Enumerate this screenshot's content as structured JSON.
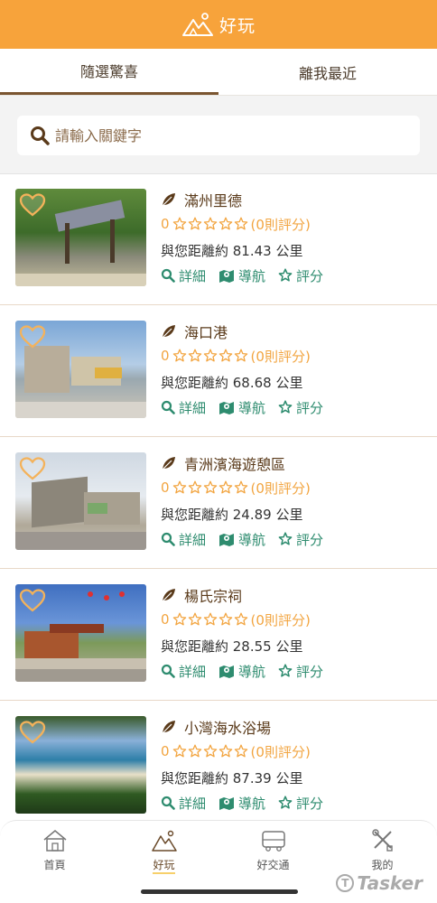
{
  "header": {
    "title": "好玩",
    "icon": "mountain-icon"
  },
  "tabs": [
    {
      "label": "隨選驚喜",
      "active": true
    },
    {
      "label": "離我最近",
      "active": false
    }
  ],
  "search": {
    "placeholder": "請輸入關鍵字",
    "value": ""
  },
  "items": [
    {
      "name": "滿州里德",
      "rating_value": "0",
      "rating_count": "(0則評分)",
      "stars": 0,
      "distance": "與您距離約 81.43 公里",
      "favorite": false
    },
    {
      "name": "海口港",
      "rating_value": "0",
      "rating_count": "(0則評分)",
      "stars": 0,
      "distance": "與您距離約 68.68 公里",
      "favorite": false
    },
    {
      "name": "青洲濱海遊憩區",
      "rating_value": "0",
      "rating_count": "(0則評分)",
      "stars": 0,
      "distance": "與您距離約 24.89 公里",
      "favorite": false
    },
    {
      "name": "楊氏宗祠",
      "rating_value": "0",
      "rating_count": "(0則評分)",
      "stars": 0,
      "distance": "與您距離約 28.55 公里",
      "favorite": false
    },
    {
      "name": "小灣海水浴場",
      "rating_value": "0",
      "rating_count": "(0則評分)",
      "stars": 0,
      "distance": "與您距離約 87.39 公里",
      "favorite": false
    }
  ],
  "actions": {
    "detail": "詳細",
    "navigate": "導航",
    "rate": "評分"
  },
  "bottom_nav": [
    {
      "label": "首頁",
      "icon": "home-icon",
      "active": false
    },
    {
      "label": "好玩",
      "icon": "mountain-icon",
      "active": true
    },
    {
      "label": "好交通",
      "icon": "bus-icon",
      "active": false
    },
    {
      "label": "我的",
      "icon": "tools-icon",
      "active": false
    }
  ],
  "watermark": "Tasker",
  "colors": {
    "accent": "#f7a33b",
    "brown": "#7a5530",
    "green": "#2e8c6f",
    "star": "#f2a541"
  }
}
